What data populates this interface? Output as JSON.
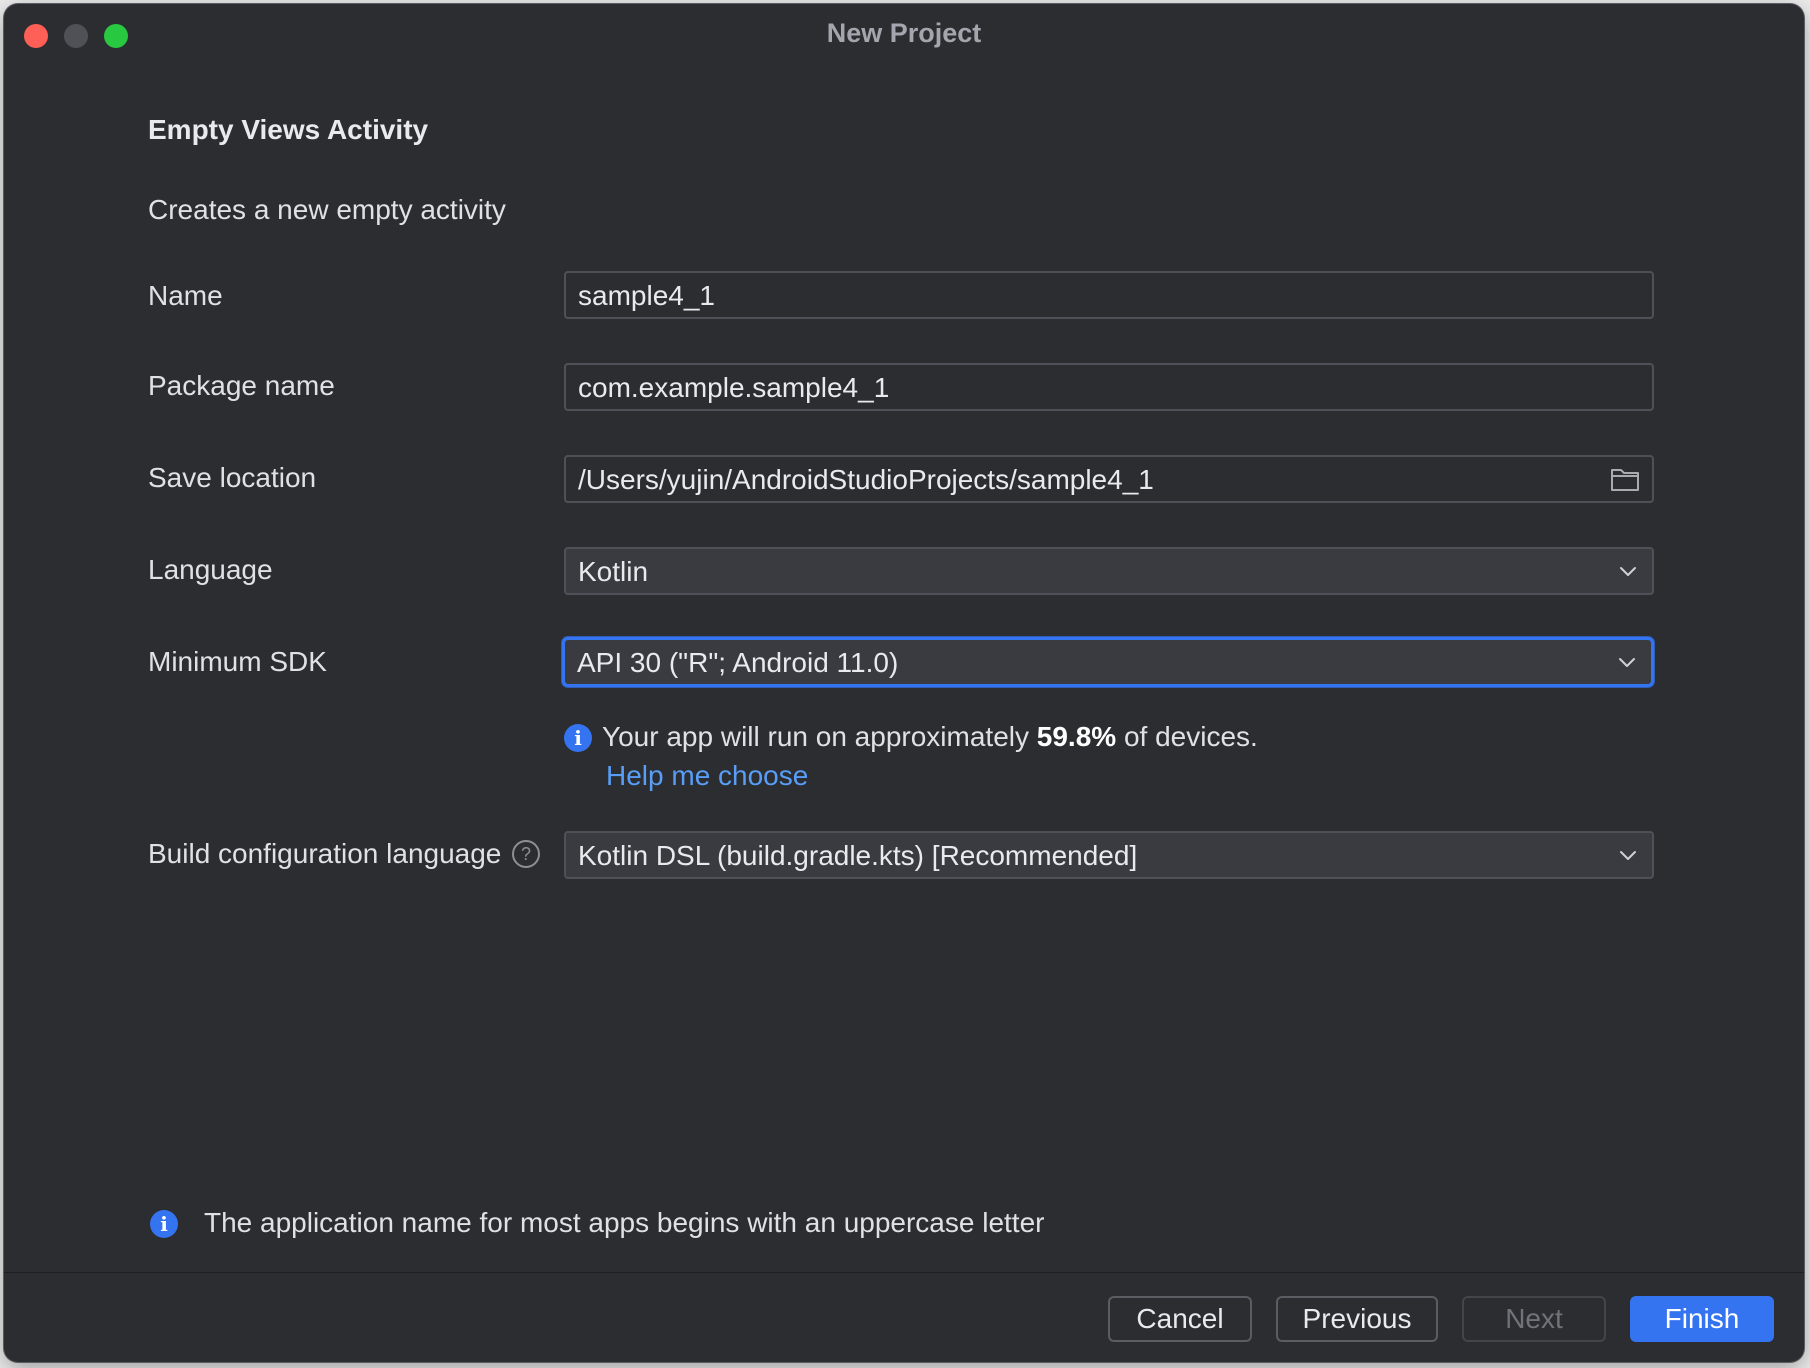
{
  "window": {
    "title": "New Project"
  },
  "header": {
    "title": "Empty Views Activity",
    "description": "Creates a new empty activity"
  },
  "form": {
    "name": {
      "label": "Name",
      "value": "sample4_1"
    },
    "package": {
      "label": "Package name",
      "value": "com.example.sample4_1"
    },
    "location": {
      "label": "Save location",
      "value": "/Users/yujin/AndroidStudioProjects/sample4_1"
    },
    "language": {
      "label": "Language",
      "value": "Kotlin"
    },
    "min_sdk": {
      "label": "Minimum SDK",
      "value": "API 30 (\"R\"; Android 11.0)",
      "info_prefix": "Your app will run on approximately ",
      "info_percent": "59.8%",
      "info_suffix": " of devices.",
      "help_link": "Help me choose"
    },
    "build_config": {
      "label": "Build configuration language",
      "value": "Kotlin DSL (build.gradle.kts) [Recommended]"
    }
  },
  "footer": {
    "note": "The application name for most apps begins with an uppercase letter"
  },
  "buttons": {
    "cancel": "Cancel",
    "previous": "Previous",
    "next": "Next",
    "finish": "Finish"
  },
  "icons": {
    "info": "i",
    "help": "?"
  },
  "colors": {
    "accent": "#3574f0",
    "link": "#589df6",
    "background": "#2b2d30"
  }
}
